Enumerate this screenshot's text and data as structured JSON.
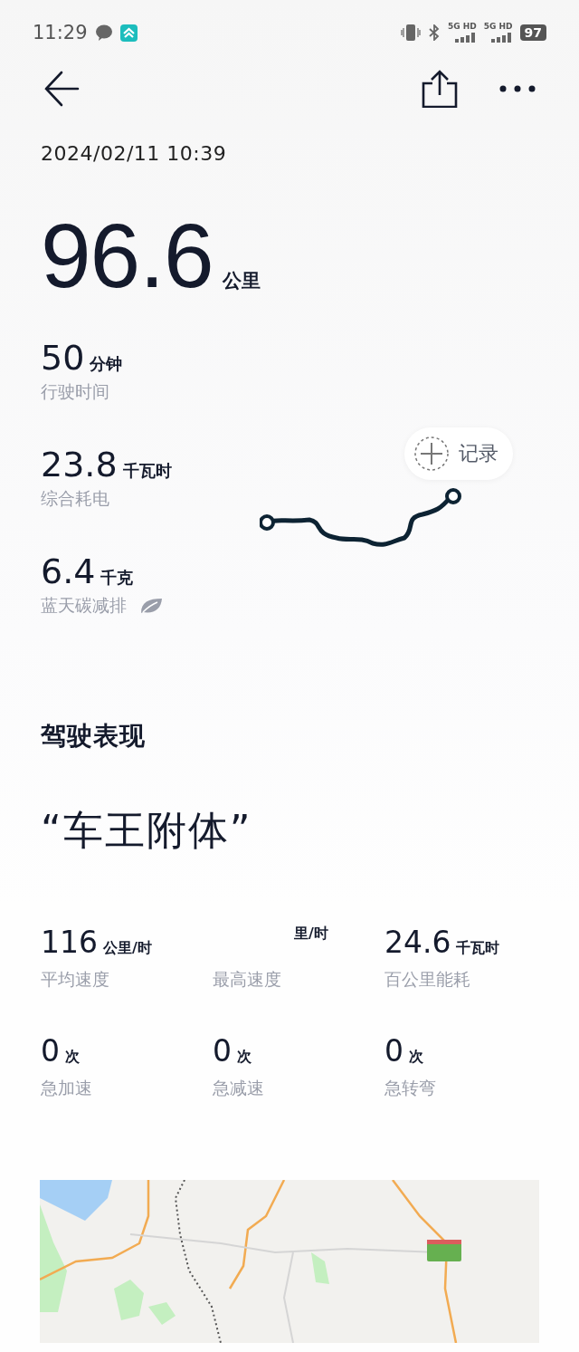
{
  "status_bar": {
    "time": "11:29",
    "network": [
      {
        "label": "5G HD"
      },
      {
        "label": "5G HD"
      }
    ],
    "battery": "97"
  },
  "date": "2024/02/11 10:39",
  "distance": {
    "value": "96.6",
    "unit": "公里"
  },
  "stats": [
    {
      "kind": "plain",
      "value": "50",
      "unit": "分钟",
      "label": "行驶时间"
    },
    {
      "kind": "plain",
      "value": "23.8",
      "unit": "千瓦时",
      "label": "综合耗电"
    },
    {
      "kind": "eco",
      "value": "6.4",
      "unit": "千克",
      "label": "蓝天碳减排"
    }
  ],
  "record_button": {
    "label": "记录"
  },
  "performance": {
    "title": "驾驶表现",
    "rating": "“车王附体”",
    "metrics": [
      {
        "value": "116",
        "unit": "公里/时",
        "label": "平均速度"
      },
      {
        "unit": "里/时",
        "label": "最高速度"
      },
      {
        "value": "24.6",
        "unit": "千瓦时",
        "label": "百公里能耗"
      },
      {
        "value": "0",
        "unit": "次",
        "label": "急加速"
      },
      {
        "value": "0",
        "unit": "次",
        "label": "急减速"
      },
      {
        "value": "0",
        "unit": "次",
        "label": "急转弯"
      }
    ]
  }
}
